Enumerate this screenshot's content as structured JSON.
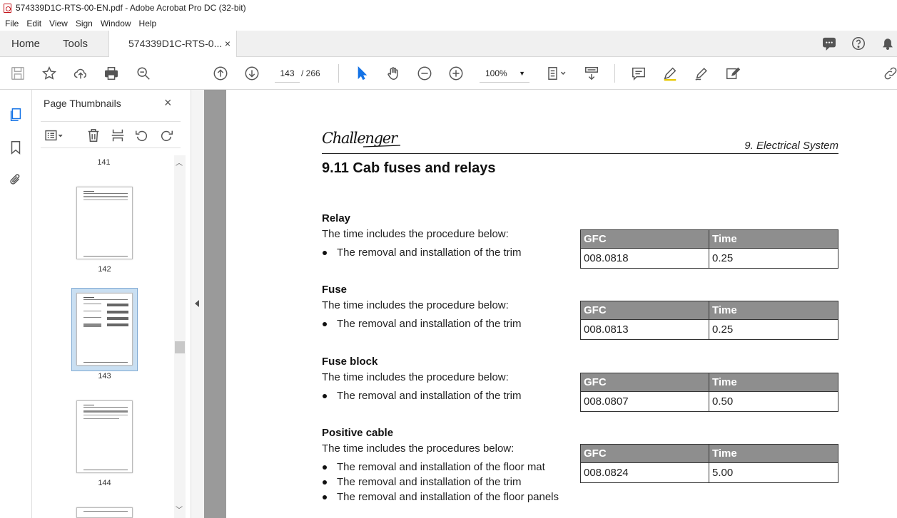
{
  "window": {
    "title": "574339D1C-RTS-00-EN.pdf - Adobe Acrobat Pro DC (32-bit)"
  },
  "menu": [
    "File",
    "Edit",
    "View",
    "Sign",
    "Window",
    "Help"
  ],
  "tabs": {
    "home": "Home",
    "tools": "Tools",
    "document": "574339D1C-RTS-0...",
    "close": "×"
  },
  "toolbar": {
    "current_page": "143",
    "page_total": "/ 266",
    "zoom": "100%"
  },
  "thumbnails": {
    "title": "Page Thumbnails",
    "close": "×",
    "pages": [
      "141",
      "142",
      "143",
      "144"
    ],
    "selected_page": "143"
  },
  "page": {
    "brand": "Challenger",
    "section_header": "9. Electrical System",
    "title": "9.11   Cab fuses and relays",
    "table_headers": {
      "gfc": "GFC",
      "time": "Time"
    },
    "sections": [
      {
        "heading": "Relay",
        "intro": "The time includes the procedure below:",
        "bullets": [
          "The removal and installation of the trim"
        ],
        "gfc": "008.0818",
        "time": "0.25"
      },
      {
        "heading": "Fuse",
        "intro": "The time includes the procedure below:",
        "bullets": [
          "The removal and installation of the trim"
        ],
        "gfc": "008.0813",
        "time": "0.25"
      },
      {
        "heading": "Fuse block",
        "intro": "The time includes the procedure below:",
        "bullets": [
          "The removal and installation of the trim"
        ],
        "gfc": "008.0807",
        "time": "0.50"
      },
      {
        "heading": "Positive cable",
        "intro": "The time includes the procedures below:",
        "bullets": [
          "The removal and installation of the floor mat",
          "The removal and installation of the trim",
          "The removal and installation of the floor panels"
        ],
        "gfc": "008.0824",
        "time": "5.00"
      }
    ]
  }
}
